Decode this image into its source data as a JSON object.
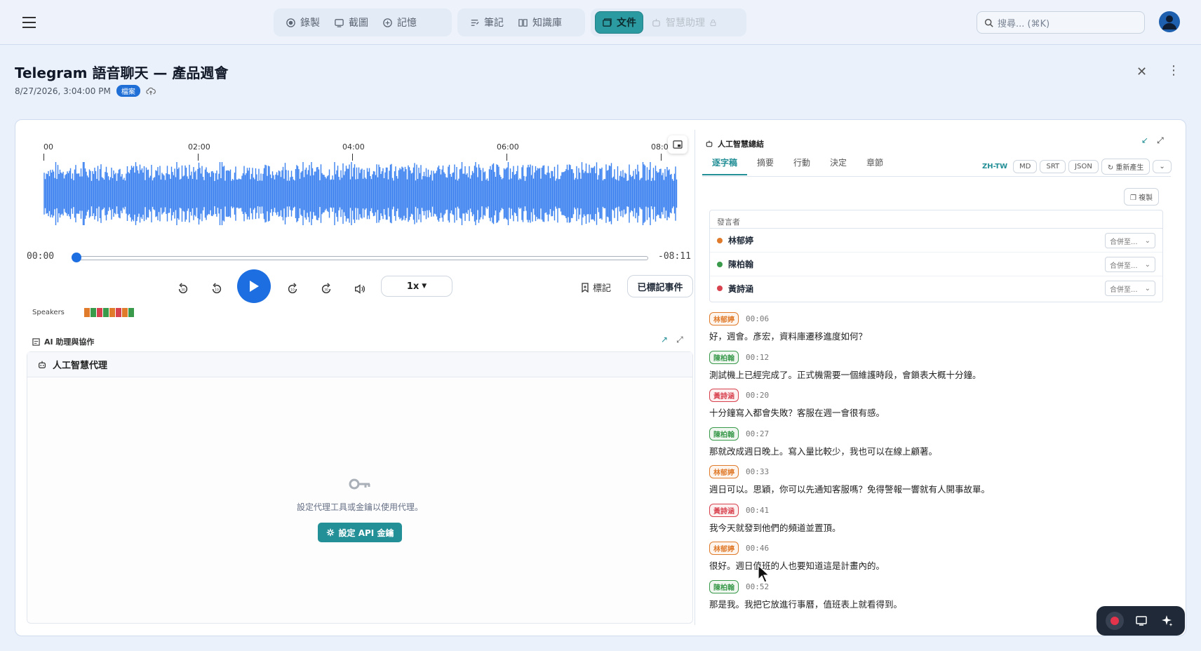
{
  "nav": {
    "group1": [
      {
        "label": "錄製",
        "icon": "record-icon"
      },
      {
        "label": "截圖",
        "icon": "screenshot-icon"
      },
      {
        "label": "記憶",
        "icon": "memory-icon"
      }
    ],
    "group2": [
      {
        "label": "筆記",
        "icon": "notes-icon"
      },
      {
        "label": "知識庫",
        "icon": "book-icon"
      }
    ],
    "documents": {
      "label": "文件",
      "state": "active"
    },
    "assistant": {
      "label": "智慧助理",
      "state": "disabled"
    },
    "search_placeholder": "搜尋... (⌘K)"
  },
  "page": {
    "title": "Telegram 語音聊天 — 產品週會",
    "datetime": "8/27/2026, 3:04:00 PM",
    "badge": "檔案"
  },
  "player": {
    "ticks": [
      "00",
      "02:00",
      "04:00",
      "06:00",
      "08:0"
    ],
    "current_time": "00:00",
    "remaining_time": "-08:11",
    "progress": 0.0,
    "speed": "1x",
    "mark_label": "標記",
    "events_label": "已標記事件",
    "speakers_label": "Speakers",
    "speaker_colors": [
      "#e07b2c",
      "#3a9a4c",
      "#d8424f",
      "#3a9a4c",
      "#e07b2c",
      "#d8424f",
      "#e07b2c",
      "#3a9a4c"
    ],
    "waveform_color": "#3b82f0"
  },
  "assistant_panel": {
    "section_title": "AI 助理與協作",
    "agent_title": "人工智慧代理",
    "empty_message": "設定代理工具或金鑰以使用代理。",
    "api_button": "設定 API 金鑰"
  },
  "summary": {
    "title": "人工智慧總結",
    "tabs": [
      "逐字稿",
      "摘要",
      "行動",
      "決定",
      "章節"
    ],
    "active_tab": "逐字稿",
    "lang": "ZH-TW",
    "formats": [
      "MD",
      "SRT",
      "JSON"
    ],
    "regenerate": "重新產生",
    "copy": "複製",
    "speaker_header": "發言者",
    "merge_label": "合併至...",
    "speakers": [
      {
        "name": "林郁婷",
        "color": "#e07b2c"
      },
      {
        "name": "陳柏翰",
        "color": "#3a9a4c"
      },
      {
        "name": "黃詩涵",
        "color": "#d8424f"
      }
    ],
    "transcript": [
      {
        "speaker": "林郁婷",
        "color": "#e07b2c",
        "time": "00:06",
        "text": "好，週會。彥宏，資料庫遷移進度如何？"
      },
      {
        "speaker": "陳柏翰",
        "color": "#3a9a4c",
        "time": "00:12",
        "text": "測試機上已經完成了。正式機需要一個維護時段，會鎖表大概十分鐘。"
      },
      {
        "speaker": "黃詩涵",
        "color": "#d8424f",
        "time": "00:20",
        "text": "十分鐘寫入都會失敗？客服在週一會很有感。"
      },
      {
        "speaker": "陳柏翰",
        "color": "#3a9a4c",
        "time": "00:27",
        "text": "那就改成週日晚上。寫入量比較少，我也可以在線上顧著。"
      },
      {
        "speaker": "林郁婷",
        "color": "#e07b2c",
        "time": "00:33",
        "text": "週日可以。思穎，你可以先通知客服嗎？免得警報一響就有人開事故單。"
      },
      {
        "speaker": "黃詩涵",
        "color": "#d8424f",
        "time": "00:41",
        "text": "我今天就發到他們的頻道並置頂。"
      },
      {
        "speaker": "林郁婷",
        "color": "#e07b2c",
        "time": "00:46",
        "text": "很好。週日值班的人也要知道這是計畫內的。"
      },
      {
        "speaker": "陳柏翰",
        "color": "#3a9a4c",
        "time": "00:52",
        "text": "那是我。我把它放進行事曆，值班表上就看得到。"
      }
    ]
  }
}
